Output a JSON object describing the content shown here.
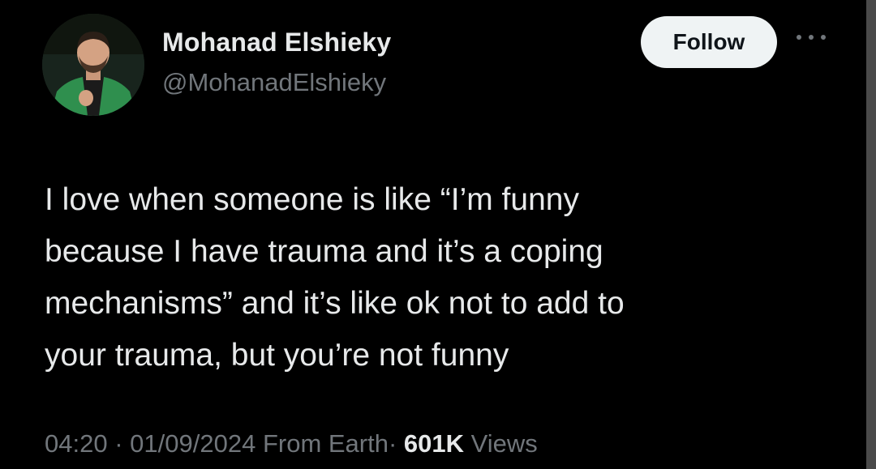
{
  "tweet": {
    "author": {
      "display_name": "Mohanad Elshieky",
      "handle": "@MohanadElshieky",
      "avatar_icon": "profile-photo"
    },
    "follow_label": "Follow",
    "more_icon": "more-options-icon",
    "text": "I love when someone is like “I’m funny\nbecause I have trauma and it’s a coping\nmechanisms” and it’s like ok not to add to\nyour trauma, but you’re not funny",
    "meta": {
      "time": "04:20",
      "separator": "·",
      "date": "01/09/2024",
      "source": "From Earth",
      "views_count": "601K",
      "views_label": "Views"
    }
  },
  "colors": {
    "background": "#000000",
    "primary_text": "#e7e9ea",
    "secondary_text": "#71767b",
    "follow_button_bg": "#eff3f4",
    "follow_button_text": "#0f1419"
  }
}
